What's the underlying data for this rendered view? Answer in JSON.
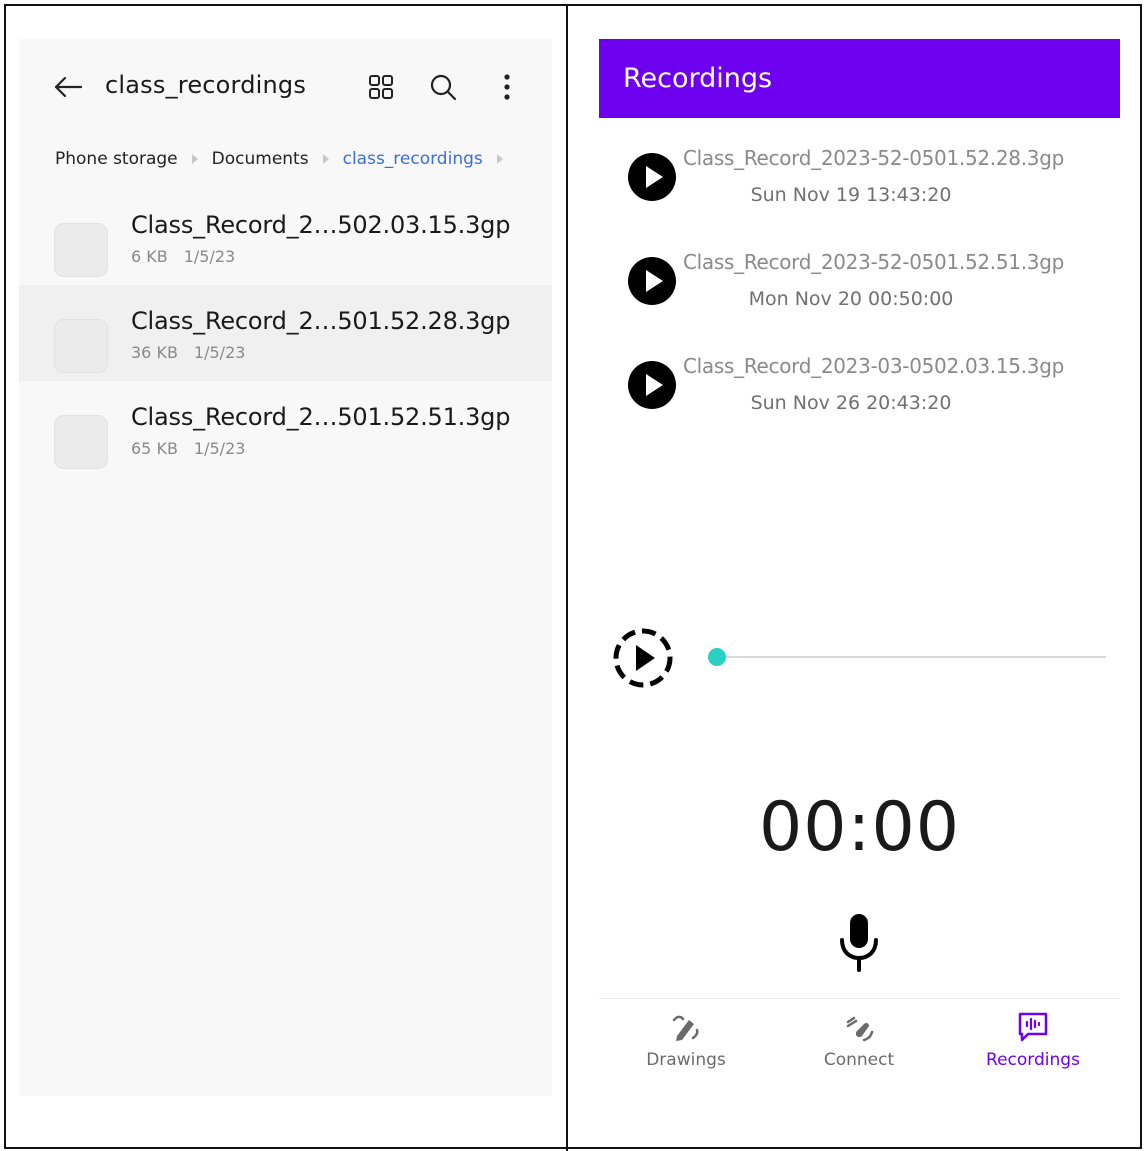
{
  "file_manager": {
    "title": "class_recordings",
    "breadcrumbs": [
      "Phone storage",
      "Documents",
      "class_recordings"
    ],
    "files": [
      {
        "name": "Class_Record_2…502.03.15.3gp",
        "size": "6 KB",
        "date": "1/5/23"
      },
      {
        "name": "Class_Record_2…501.52.28.3gp",
        "size": "36 KB",
        "date": "1/5/23"
      },
      {
        "name": "Class_Record_2…501.52.51.3gp",
        "size": "65 KB",
        "date": "1/5/23"
      }
    ],
    "icons": [
      "back-arrow-icon",
      "grid-view-icon",
      "search-icon",
      "more-vertical-icon",
      "file-thumbnail"
    ]
  },
  "recordings_app": {
    "title": "Recordings",
    "header_color": "#6d00ee",
    "recordings": [
      {
        "name": "Class_Record_2023-52-0501.52.28.3gp",
        "date": "Sun Nov 19 13:43:20"
      },
      {
        "name": "Class_Record_2023-52-0501.52.51.3gp",
        "date": "Mon Nov 20 00:50:00"
      },
      {
        "name": "Class_Record_2023-03-0502.03.15.3gp",
        "date": "Sun Nov 26 20:43:20"
      }
    ],
    "player": {
      "progress": 0,
      "accent_color": "#2ad1c3"
    },
    "timer": "00:00",
    "nav": [
      {
        "label": "Drawings",
        "icon": "drawings-icon",
        "active": false
      },
      {
        "label": "Connect",
        "icon": "connect-icon",
        "active": false
      },
      {
        "label": "Recordings",
        "icon": "recordings-icon",
        "active": true
      }
    ],
    "active_nav_color": "#6d00ee"
  }
}
